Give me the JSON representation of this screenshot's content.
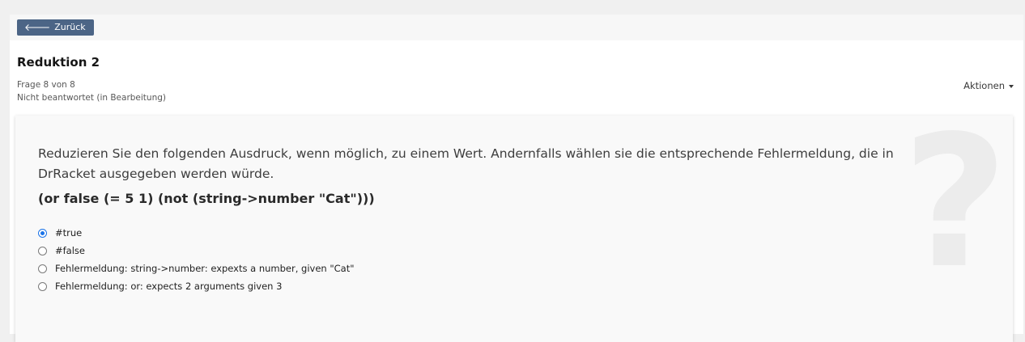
{
  "toolbar": {
    "back_label": "Zurück"
  },
  "question": {
    "title": "Reduktion 2",
    "progress": "Frage 8 von 8",
    "status": "Nicht beantwortet (in Bearbeitung)",
    "actions_label": "Aktionen",
    "text": "Reduzieren Sie den folgenden Ausdruck, wenn möglich, zu einem Wert. Andernfalls wählen sie die entsprechende Fehlermeldung, die in DrRacket ausgegeben werden würde.",
    "expression": "(or false (= 5 1) (not (string->number \"Cat\")))",
    "options": [
      {
        "label": "#true",
        "selected": true
      },
      {
        "label": "#false",
        "selected": false
      },
      {
        "label": "Fehlermeldung: string->number: expexts a number, given \"Cat\"",
        "selected": false
      },
      {
        "label": "Fehlermeldung: or: expects 2 arguments given 3",
        "selected": false
      }
    ]
  },
  "icons": {
    "back": "arrow-left-icon",
    "decor": "question-mark-icon"
  },
  "colors": {
    "accent": "#4c6586",
    "radio_selected": "#1a73e8"
  }
}
